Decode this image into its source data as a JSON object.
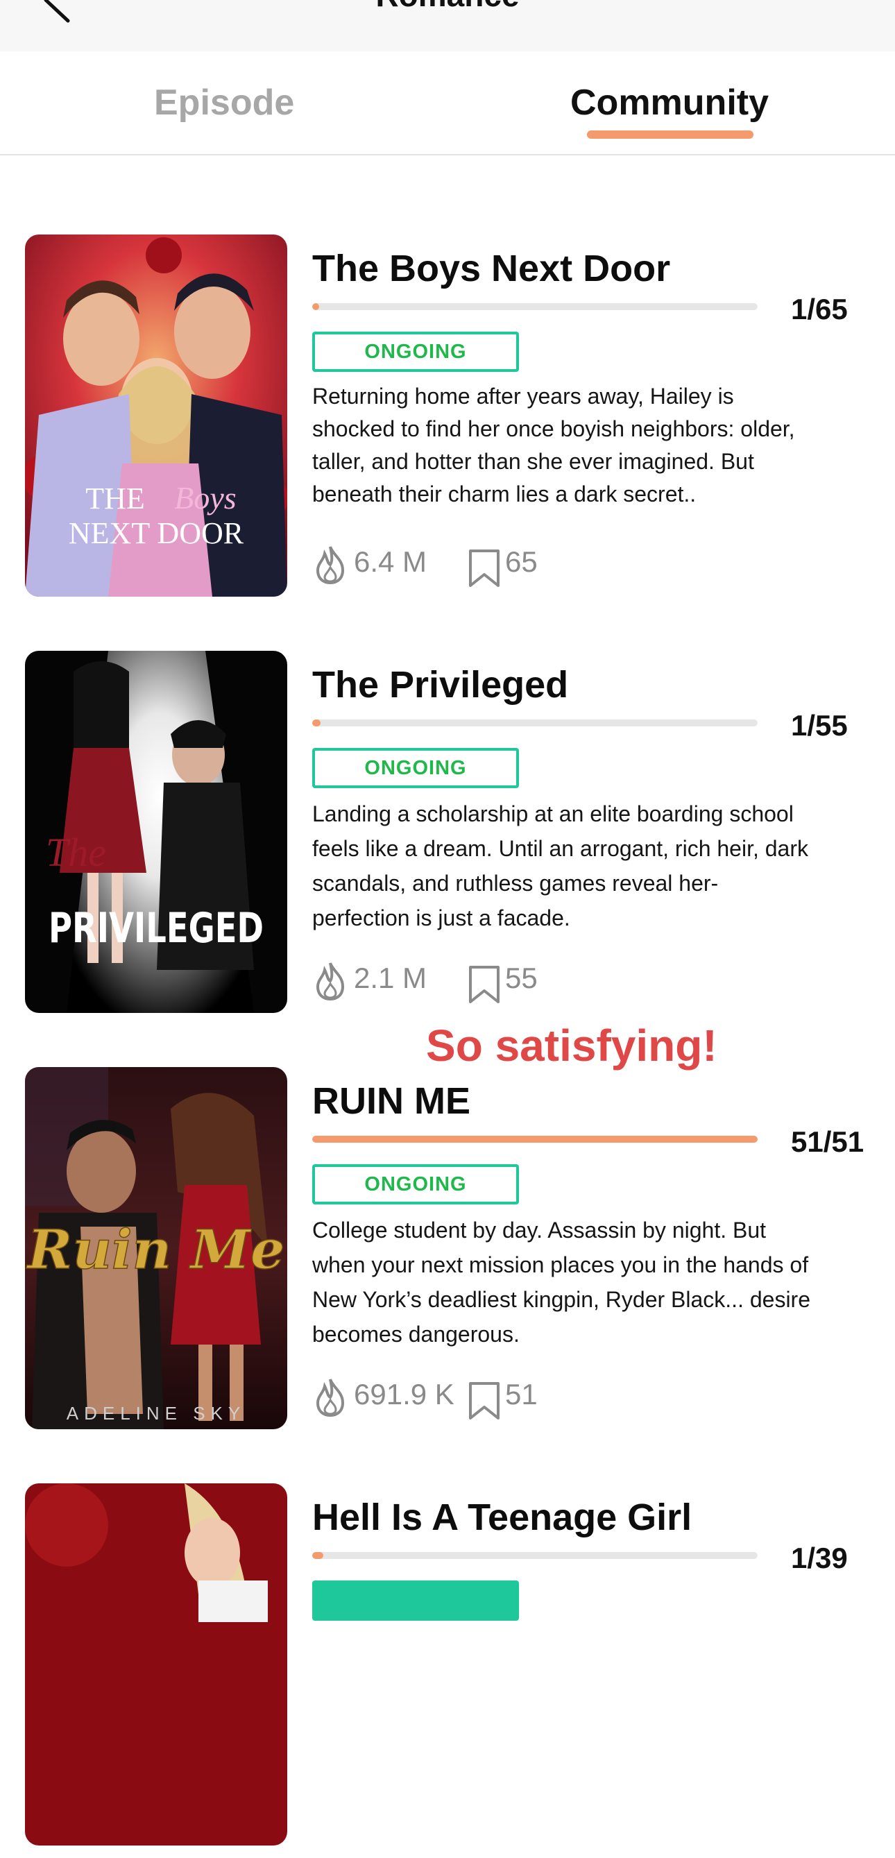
{
  "header": {
    "title": "Romance",
    "back_icon": "back-arrow-icon"
  },
  "tabs": [
    {
      "label": "Episode",
      "active": false
    },
    {
      "label": "Community",
      "active": true
    }
  ],
  "colors": {
    "accent": "#f59a6c",
    "badge_border": "#1ec89a",
    "badge_text": "#1fb84a",
    "caption": "#e04848"
  },
  "overlay_caption": "So satisfying!",
  "stories": [
    {
      "title": "The Boys Next Door",
      "progress": "1/65",
      "progress_fraction": 0.0154,
      "status": "ONGOING",
      "description": "Returning home after years away, Hailey is shocked to find her once boyish neighbors: older, taller, and hotter than she ever imagined. But beneath their charm lies a dark secret..",
      "views": "6.4 M",
      "bookmarks": "65",
      "cover_text": [
        "THE",
        "Boys",
        "NEXT DOOR"
      ]
    },
    {
      "title": "The Privileged",
      "progress": "1/55",
      "progress_fraction": 0.0182,
      "status": "ONGOING",
      "description": "Landing a scholarship at an elite boarding school feels like a dream. Until an arrogant, rich heir, dark scandals, and ruthless games reveal her- perfection is just a facade.",
      "views": "2.1 M",
      "bookmarks": "55",
      "cover_text": [
        "The",
        "PRIVILEGED"
      ]
    },
    {
      "title": "RUIN ME",
      "progress": "51/51",
      "progress_fraction": 1.0,
      "status": "ONGOING",
      "description": "College student by day. Assassin by night. But when your next mission places you in the hands of New York’s deadliest kingpin, Ryder Black... desire becomes dangerous.",
      "views": "691.9 K",
      "bookmarks": "51",
      "cover_text": [
        "Ruin Me",
        "ADELINE SKY"
      ]
    },
    {
      "title": "Hell Is A Teenage Girl",
      "progress": "1/39",
      "progress_fraction": 0.0256,
      "status": "",
      "description": "",
      "views": "",
      "bookmarks": "",
      "cover_text": []
    }
  ]
}
